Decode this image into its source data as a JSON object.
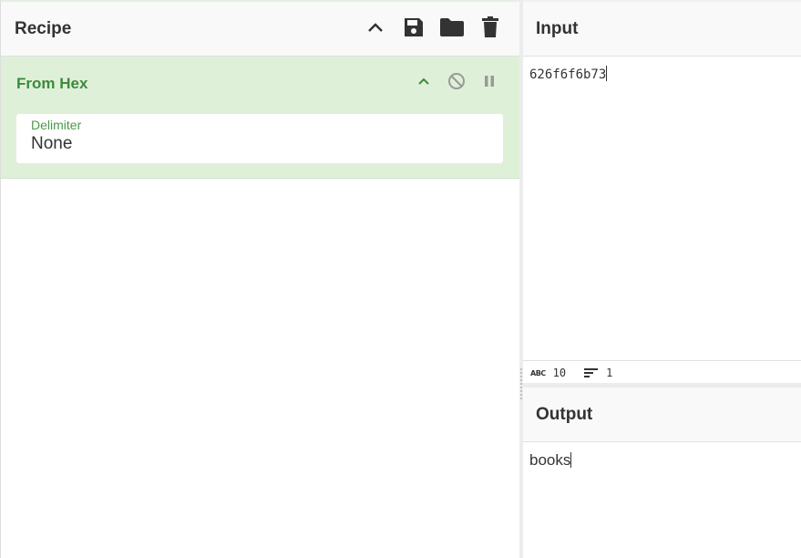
{
  "recipe": {
    "title": "Recipe",
    "controls": [
      "chevron-up-icon",
      "save-icon",
      "folder-icon",
      "trash-icon"
    ]
  },
  "operation": {
    "title": "From Hex",
    "arg_label": "Delimiter",
    "arg_value": "None",
    "controls": [
      "chevron-up-icon",
      "disable-icon",
      "pause-icon"
    ]
  },
  "input": {
    "title": "Input",
    "value": "626f6f6b73",
    "status": {
      "length": "10",
      "lines": "1"
    }
  },
  "output": {
    "title": "Output",
    "value": "books"
  },
  "colors": {
    "operation_bg": "#dff0d8",
    "operation_title": "#3c8b3c",
    "header_bg": "#f9f9f9"
  }
}
